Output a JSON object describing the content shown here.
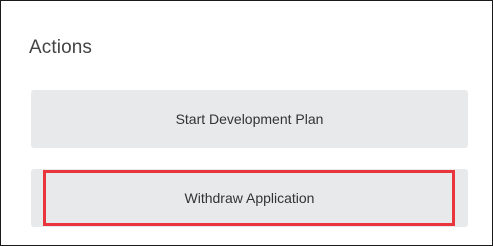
{
  "actions_panel": {
    "title": "Actions",
    "buttons": [
      {
        "label": "Start Development Plan"
      },
      {
        "label": "Withdraw Application"
      }
    ],
    "highlight_color": "#e8363c",
    "button_color": "#e7e9eb"
  }
}
